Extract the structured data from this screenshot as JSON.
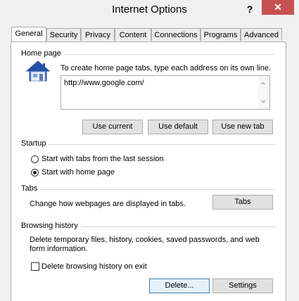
{
  "window": {
    "title": "Internet Options",
    "help_label": "?",
    "close_label": "✕"
  },
  "tabs": [
    {
      "label": "General",
      "active": true
    },
    {
      "label": "Security",
      "active": false
    },
    {
      "label": "Privacy",
      "active": false
    },
    {
      "label": "Content",
      "active": false
    },
    {
      "label": "Connections",
      "active": false
    },
    {
      "label": "Programs",
      "active": false
    },
    {
      "label": "Advanced",
      "active": false
    }
  ],
  "home_page": {
    "group_label": "Home page",
    "description": "To create home page tabs, type each address on its own line.",
    "url_value": "http://www.google.com/",
    "icon": "house-icon",
    "buttons": {
      "use_current": "Use current",
      "use_default": "Use default",
      "use_new_tab": "Use new tab"
    }
  },
  "startup": {
    "group_label": "Startup",
    "options": [
      {
        "label": "Start with tabs from the last session",
        "checked": false
      },
      {
        "label": "Start with home page",
        "checked": true
      }
    ]
  },
  "tabs_section": {
    "group_label": "Tabs",
    "description": "Change how webpages are displayed in tabs.",
    "button": "Tabs"
  },
  "browsing_history": {
    "group_label": "Browsing history",
    "description_line1": "Delete temporary files, history, cookies, saved passwords, and web",
    "description_line2": "form information.",
    "delete_on_exit_label": "Delete browsing history on exit",
    "delete_on_exit_checked": false,
    "buttons": {
      "delete": "Delete...",
      "settings": "Settings"
    }
  },
  "colors": {
    "close_button": "#c75050",
    "focus_border": "#3c7fb1"
  }
}
